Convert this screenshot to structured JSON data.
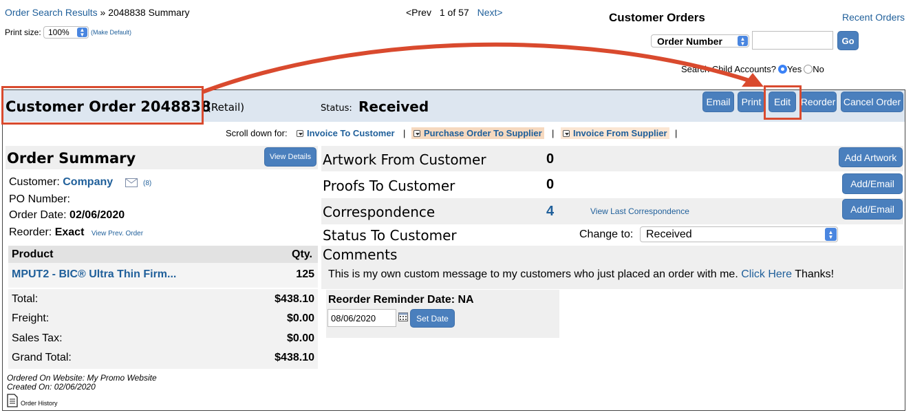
{
  "header": {
    "breadcrumb_link": "Order Search Results",
    "breadcrumb_sep": "»",
    "breadcrumb_current": "2048838 Summary",
    "print_size_label": "Print size:",
    "print_size_value": "100%",
    "make_default": "(Make Default)",
    "prev": "<Prev",
    "page_info": "1 of 57",
    "next": "Next>",
    "customer_orders_title": "Customer Orders",
    "recent_orders": "Recent Orders",
    "search_type": "Order Number",
    "search_value": "",
    "go": "Go",
    "child_accounts_label": "Search Child Accounts?",
    "yes": "Yes",
    "no": "No"
  },
  "order": {
    "title": "Customer Order 2048838",
    "type": "(Retail)",
    "status_label": "Status:",
    "status_value": "Received",
    "buttons": [
      "Email",
      "Print",
      "Edit",
      "Reorder",
      "Cancel Order"
    ]
  },
  "scroll": {
    "label": "Scroll down for:",
    "links": [
      "Invoice To Customer",
      "Purchase Order To Supplier",
      "Invoice From Supplier"
    ],
    "sep": "|"
  },
  "summary": {
    "title": "Order Summary",
    "view_details": "View Details",
    "customer_label": "Customer:",
    "customer_name": "Company",
    "message_count": "(8)",
    "po_label": "PO Number:",
    "po_value": "",
    "order_date_label": "Order Date:",
    "order_date_value": "02/06/2020",
    "reorder_label": "Reorder:",
    "reorder_value": "Exact",
    "view_prev_order": "View Prev. Order",
    "product_header": "Product",
    "qty_header": "Qty.",
    "product_name": "MPUT2 - BIC® Ultra Thin Firm...",
    "product_qty": "125",
    "total_label": "Total:",
    "total_value": "$438.10",
    "freight_label": "Freight:",
    "freight_value": "$0.00",
    "tax_label": "Sales Tax:",
    "tax_value": "$0.00",
    "grand_label": "Grand Total:",
    "grand_value": "$438.10",
    "ordered_on": "Ordered On Website: My Promo Website",
    "created_on": "Created On: 02/06/2020",
    "order_history": "Order History"
  },
  "details": {
    "artwork_label": "Artwork From Customer",
    "artwork_count": "0",
    "add_artwork": "Add Artwork",
    "proofs_label": "Proofs To Customer",
    "proofs_count": "0",
    "add_email": "Add/Email",
    "correspondence_label": "Correspondence",
    "correspondence_count": "4",
    "view_last_correspondence": "View Last Correspondence",
    "status_label": "Status To Customer",
    "change_to_label": "Change to:",
    "change_to_value": "Received",
    "comments_label": "Comments",
    "comments_text": "This is my own custom message to my customers who just placed an order with me.",
    "click_here": "Click Here",
    "thanks": "Thanks!",
    "reminder_label": "Reorder Reminder Date: NA",
    "reminder_date": "08/06/2020",
    "set_date": "Set Date"
  },
  "colors": {
    "annotation_red": "#d94a2e",
    "button_blue": "#4a7fbd",
    "link_blue": "#1f5f9a",
    "header_band": "#dde6f0"
  }
}
